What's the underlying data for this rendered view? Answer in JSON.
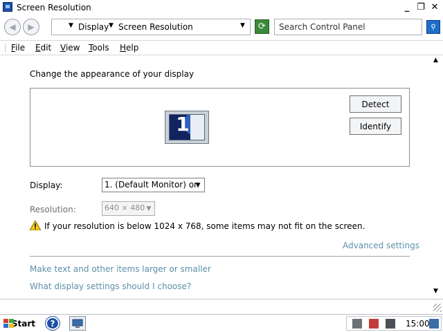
{
  "window": {
    "title": "Screen Resolution",
    "controls": {
      "minimize": "_",
      "maximize": "❐",
      "close": "✕"
    }
  },
  "addressbar": {
    "breadcrumb": [
      "Display",
      "Screen Resolution"
    ],
    "search_placeholder": "Search Control Panel"
  },
  "menu": {
    "items": [
      "File",
      "Edit",
      "View",
      "Tools",
      "Help"
    ]
  },
  "content": {
    "heading": "Change the appearance of your display",
    "monitor_number": "1",
    "detect_label": "Detect",
    "identify_label": "Identify",
    "display_label": "Display:",
    "display_value": "1. (Default Monitor) on",
    "resolution_label": "Resolution:",
    "resolution_value": "640 × 480",
    "warning_text": "If your resolution is below 1024 x 768, some items may not fit on the screen.",
    "advanced_link": "Advanced settings",
    "links": [
      "Make text and other items larger or smaller",
      "What display settings should I choose?"
    ]
  },
  "taskbar": {
    "start_label": "Start",
    "help_glyph": "?",
    "clock": "15:00"
  },
  "colors": {
    "link": "#5a8fa8",
    "accent": "#1c4fa8",
    "disabled_text": "#8e8e8e"
  }
}
